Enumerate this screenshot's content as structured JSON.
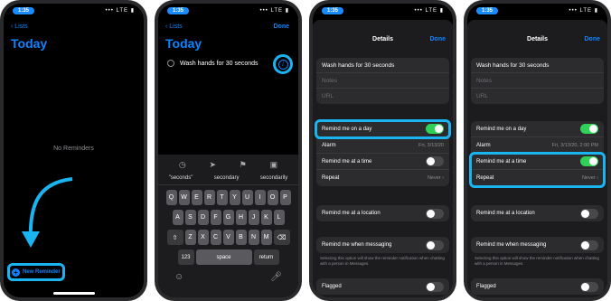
{
  "status": {
    "time": "1:35",
    "signal": "••• LTE ▮"
  },
  "screen1": {
    "back": "Lists",
    "title": "Today",
    "empty_text": "No Reminders",
    "new_reminder": "New Reminder"
  },
  "screen2": {
    "back": "Lists",
    "title": "Today",
    "done": "Done",
    "reminder_text": "Wash hands for 30 seconds",
    "suggestions": [
      "\"seconds\"",
      "secondary",
      "secondarily"
    ],
    "keyboard_rows": [
      [
        "Q",
        "W",
        "E",
        "R",
        "T",
        "Y",
        "U",
        "I",
        "O",
        "P"
      ],
      [
        "A",
        "S",
        "D",
        "F",
        "G",
        "H",
        "J",
        "K",
        "L"
      ],
      [
        "Z",
        "X",
        "C",
        "V",
        "B",
        "N",
        "M"
      ]
    ],
    "key_123": "123",
    "key_space": "space",
    "key_return": "return",
    "key_shift": "⇧",
    "key_delete": "⌫",
    "tool_icons": [
      "clock-icon",
      "location-icon",
      "flag-icon",
      "camera-icon"
    ]
  },
  "details": {
    "title": "Details",
    "done": "Done",
    "name": "Wash hands for 30 seconds",
    "notes_placeholder": "Notes",
    "url_placeholder": "URL",
    "remind_day": "Remind me on a day",
    "alarm": "Alarm",
    "alarm_date_3": "Fri, 3/13/20",
    "alarm_date_4": "Fri, 3/13/20, 2:00 PM",
    "remind_time": "Remind me at a time",
    "repeat": "Repeat",
    "repeat_value": "Never",
    "remind_location": "Remind me at a location",
    "remind_messaging": "Remind me when messaging",
    "messaging_note": "Selecting this option will show the reminder notification when chatting with a person in Messages.",
    "flagged": "Flagged"
  },
  "colors": {
    "accent": "#0a84ff",
    "highlight": "#1ab4f0",
    "toggle_on": "#30d158"
  }
}
